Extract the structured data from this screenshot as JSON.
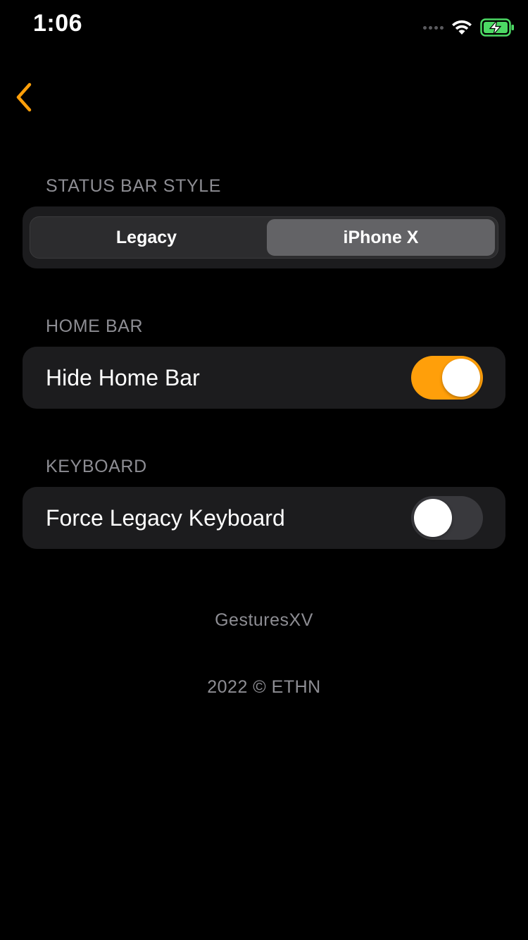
{
  "status_bar": {
    "time": "1:06",
    "signal_icon": "signal-dots-icon",
    "wifi_icon": "wifi-icon",
    "battery_icon": "battery-charging-icon",
    "battery_color": "#4cd964"
  },
  "nav": {
    "back_icon": "chevron-left-icon",
    "accent_color": "#ff9f0a"
  },
  "sections": {
    "status_bar_style": {
      "header": "STATUS BAR STYLE",
      "options": [
        "Legacy",
        "iPhone X"
      ],
      "selected": "iPhone X"
    },
    "home_bar": {
      "header": "HOME BAR",
      "row_label": "Hide Home Bar",
      "toggle_on": true
    },
    "keyboard": {
      "header": "KEYBOARD",
      "row_label": "Force Legacy Keyboard",
      "toggle_on": false
    }
  },
  "footer": {
    "app_name": "GesturesXV",
    "copyright": "2022 © ETHN"
  }
}
